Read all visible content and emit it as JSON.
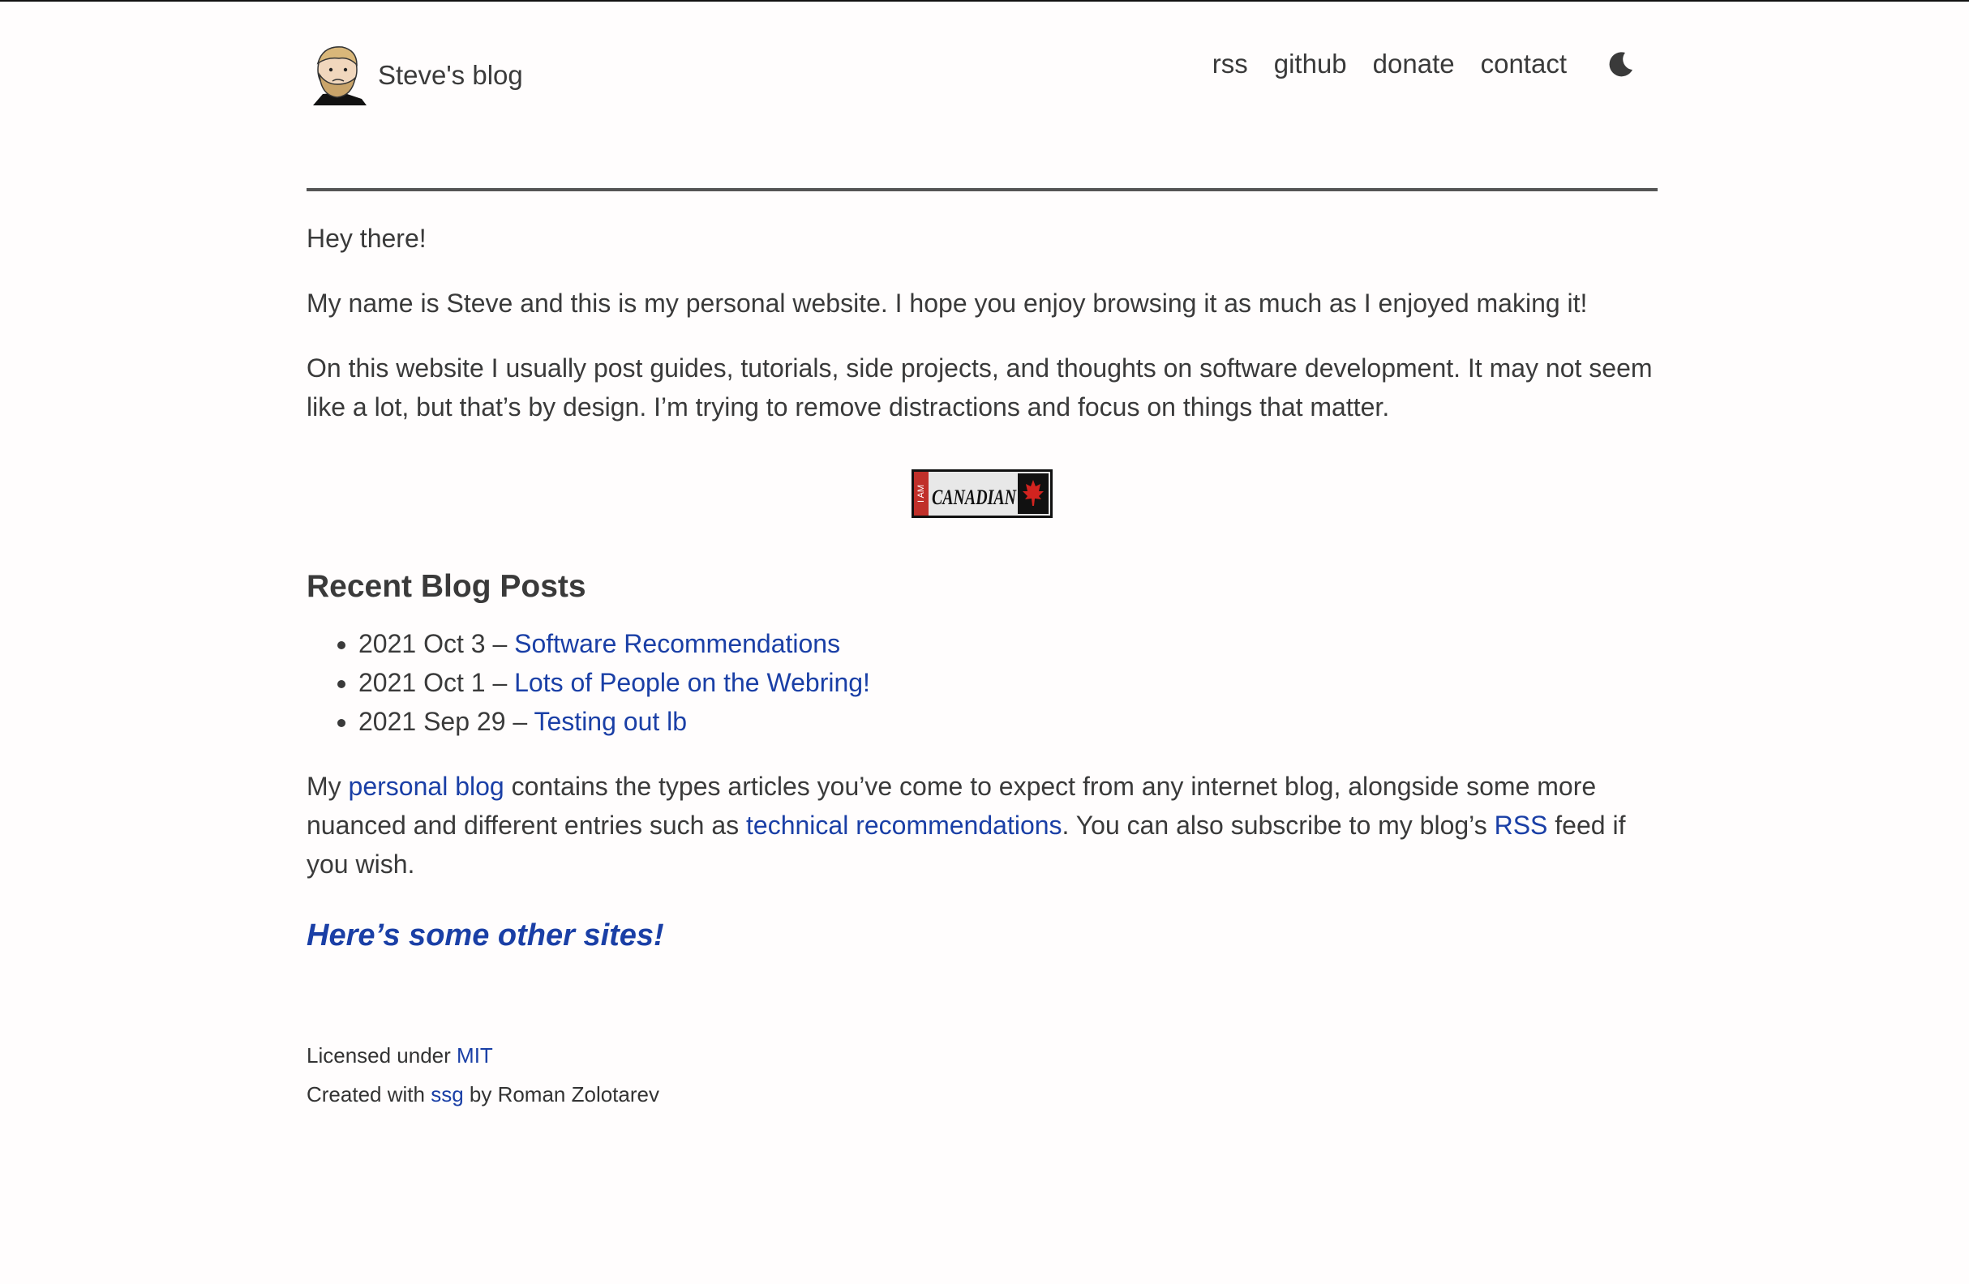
{
  "header": {
    "site_title": "Steve's blog",
    "nav": [
      "rss",
      "github",
      "donate",
      "contact"
    ],
    "theme_toggle_icon": "moon-icon"
  },
  "intro": {
    "greeting": "Hey there!",
    "p1": "My name is Steve and this is my personal website. I hope you enjoy browsing it as much as I enjoyed making it!",
    "p2": "On this website I usually post guides, tutorials, side projects, and thoughts on software development. It may not seem like a lot, but that’s by design. I’m trying to remove distractions and focus on things that matter."
  },
  "badge": {
    "icon": "canadian-flag-badge",
    "text_side": "I AM",
    "text_main": "CANADIAN"
  },
  "recent": {
    "heading": "Recent Blog Posts",
    "posts": [
      {
        "date": "2021 Oct 3 – ",
        "title": "Software Recommendations"
      },
      {
        "date": "2021 Oct 1 – ",
        "title": "Lots of People on the Webring!"
      },
      {
        "date": "2021 Sep 29 – ",
        "title": "Testing out lb"
      }
    ]
  },
  "about": {
    "t1": "My ",
    "l1": "personal blog",
    "t2": " contains the types articles you’ve come to expect from any internet blog, alongside some more nuanced and different entries such as ",
    "l2": "technical recommendations",
    "t3": ". You can also subscribe to my blog’s ",
    "l3": "RSS",
    "t4": " feed if you wish."
  },
  "other_sites": "Here’s some other sites!",
  "footer": {
    "licensed_prefix": "Licensed under ",
    "license": "MIT",
    "created_prefix": "Created with ",
    "tool": "ssg",
    "created_suffix": " by Roman Zolotarev"
  },
  "colors": {
    "link": "#1a3fa6",
    "text": "#3a3a3a",
    "background": "#fffdfd",
    "rule": "#555555"
  }
}
